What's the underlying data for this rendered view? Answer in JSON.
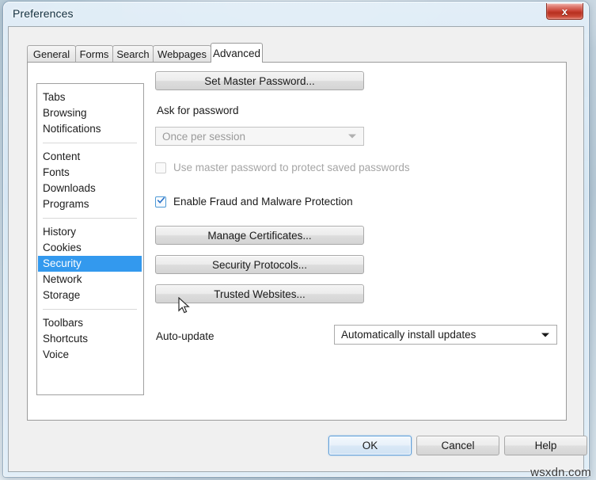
{
  "window": {
    "title": "Preferences",
    "close_icon": "close-icon",
    "close_glyph": "x"
  },
  "tabs": [
    {
      "label": "General",
      "active": false
    },
    {
      "label": "Forms",
      "active": false
    },
    {
      "label": "Search",
      "active": false
    },
    {
      "label": "Webpages",
      "active": false
    },
    {
      "label": "Advanced",
      "active": true
    }
  ],
  "sidebar": {
    "groups": [
      {
        "items": [
          "Tabs",
          "Browsing",
          "Notifications"
        ]
      },
      {
        "items": [
          "Content",
          "Fonts",
          "Downloads",
          "Programs"
        ]
      },
      {
        "items": [
          "History",
          "Cookies",
          "Security",
          "Network",
          "Storage"
        ]
      },
      {
        "items": [
          "Toolbars",
          "Shortcuts",
          "Voice"
        ]
      }
    ],
    "selected": "Security"
  },
  "panel": {
    "set_master_password_button": "Set Master Password...",
    "ask_for_password_label": "Ask for password",
    "ask_for_password_value": "Once per session",
    "use_master_password_checkbox": "Use master password to protect saved passwords",
    "enable_fraud_checkbox": "Enable Fraud and Malware Protection",
    "manage_certificates_button": "Manage Certificates...",
    "security_protocols_button": "Security Protocols...",
    "trusted_websites_button": "Trusted Websites...",
    "auto_update_label": "Auto-update",
    "auto_update_value": "Automatically install updates"
  },
  "footer": {
    "ok": "OK",
    "cancel": "Cancel",
    "help": "Help"
  },
  "watermark": "wsxdn.com",
  "colors": {
    "selection_blue": "#3399ee",
    "close_red": "#c63c2e",
    "window_bg": "#f0f0f0",
    "panel_white": "#ffffff",
    "default_button_border": "#5b9dd9"
  }
}
